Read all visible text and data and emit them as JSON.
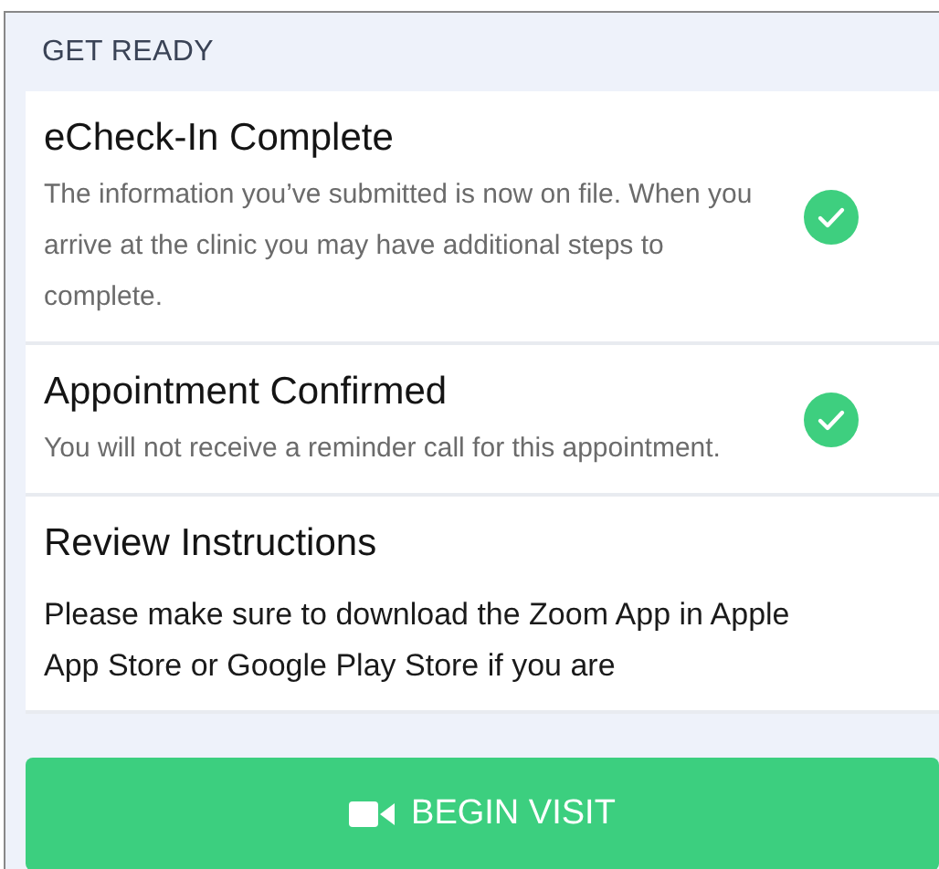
{
  "section": {
    "title": "GET READY"
  },
  "steps": [
    {
      "kind": "status",
      "title": "eCheck-In Complete",
      "text": "The information you’ve submitted is now on file. When you arrive at the clinic you may have additional steps to complete.",
      "checked": true
    },
    {
      "kind": "status",
      "title": "Appointment Confirmed",
      "text": "You will not receive a reminder call for this appointment.",
      "checked": true
    },
    {
      "kind": "instructions",
      "title": "Review Instructions",
      "text": "Please make sure to download the Zoom App in Apple App Store or Google Play Store if you are"
    }
  ],
  "action_button": {
    "label": "BEGIN VISIT"
  }
}
